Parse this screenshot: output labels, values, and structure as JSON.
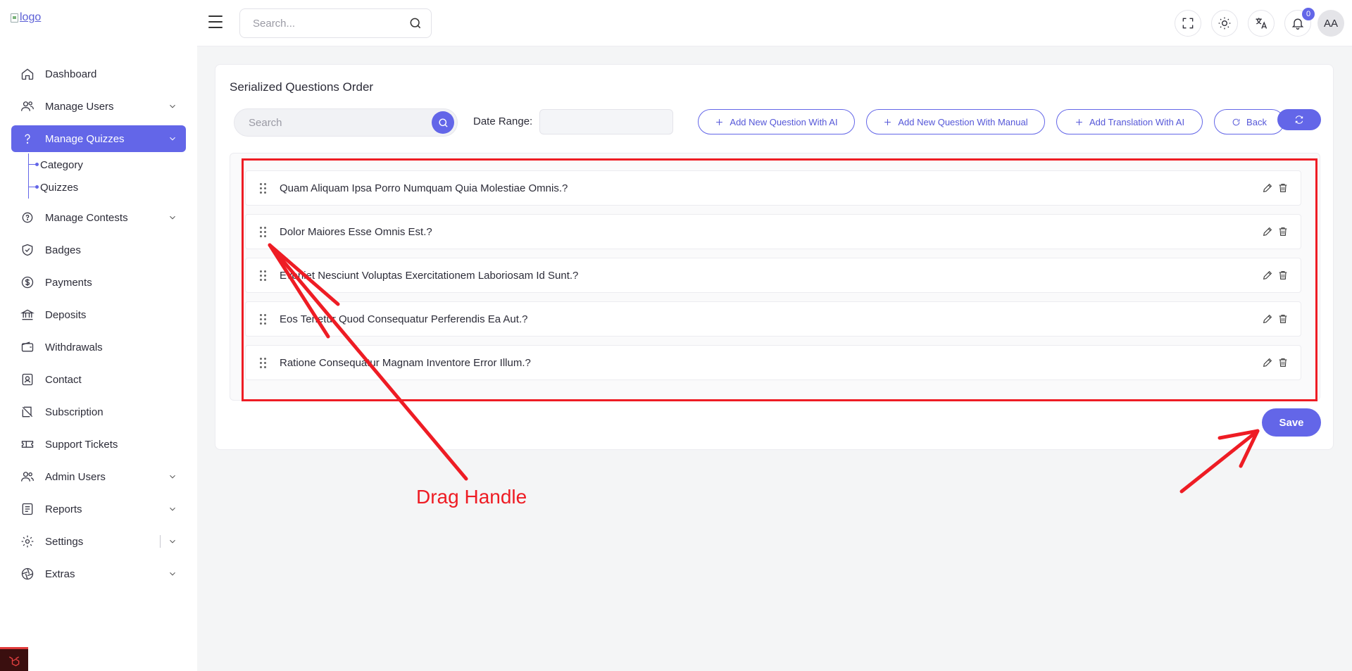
{
  "app": {
    "logo_alt": "logo"
  },
  "topbar": {
    "search_placeholder": "Search...",
    "notification_count": "0",
    "avatar_initials": "AA"
  },
  "sidebar": {
    "items": [
      {
        "label": "Dashboard",
        "icon": "home-icon"
      },
      {
        "label": "Manage Users",
        "icon": "users-icon",
        "has_children": true
      },
      {
        "label": "Manage Quizzes",
        "icon": "question-icon",
        "has_children": true,
        "active": true
      },
      {
        "label": "Manage Contests",
        "icon": "contest-icon",
        "has_children": true
      },
      {
        "label": "Badges",
        "icon": "shield-check-icon"
      },
      {
        "label": "Payments",
        "icon": "dollar-icon"
      },
      {
        "label": "Deposits",
        "icon": "bank-icon"
      },
      {
        "label": "Withdrawals",
        "icon": "wallet-icon"
      },
      {
        "label": "Contact",
        "icon": "contact-icon"
      },
      {
        "label": "Subscription",
        "icon": "subscription-icon"
      },
      {
        "label": "Support Tickets",
        "icon": "ticket-icon"
      },
      {
        "label": "Admin Users",
        "icon": "admin-users-icon",
        "has_children": true
      },
      {
        "label": "Reports",
        "icon": "report-icon",
        "has_children": true
      },
      {
        "label": "Settings",
        "icon": "gear-icon",
        "has_children": true
      },
      {
        "label": "Extras",
        "icon": "aperture-icon",
        "has_children": true
      }
    ],
    "sub_items": [
      "Category",
      "Quizzes"
    ]
  },
  "page": {
    "title": "Serialized Questions Order",
    "search_placeholder": "Search",
    "date_range_label": "Date Range:",
    "buttons": {
      "add_ai": "Add New Question With AI",
      "add_manual": "Add New Question With Manual",
      "add_translation": "Add Translation With AI",
      "back": "Back"
    },
    "questions": [
      "Quam Aliquam Ipsa Porro Numquam Quia Molestiae Omnis.?",
      "Dolor Maiores Esse Omnis Est.?",
      "Eveniet Nesciunt Voluptas Exercitationem Laboriosam Id Sunt.?",
      "Eos Tenetur Quod Consequatur Perferendis Ea Aut.?",
      "Ratione Consequatur Magnam Inventore Error Illum.?"
    ],
    "save_label": "Save"
  },
  "annotation": {
    "label": "Drag Handle",
    "color": "#ee1c24"
  },
  "colors": {
    "accent": "#6366e8",
    "annotation": "#ee1c24"
  }
}
